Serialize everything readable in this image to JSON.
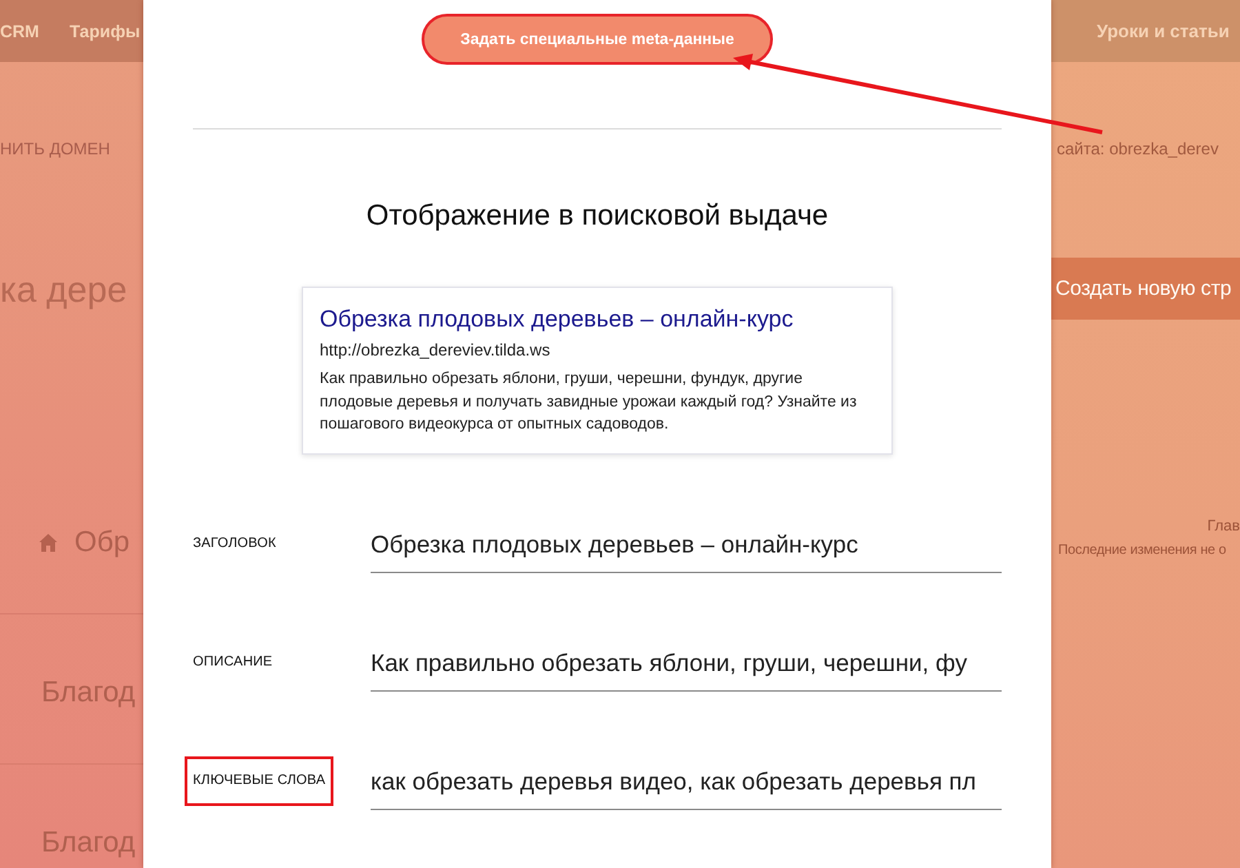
{
  "background_page": {
    "left": {
      "nav_items": [
        "CRM",
        "Тарифы"
      ],
      "domain_link": "НИТЬ ДОМЕН",
      "project_title": "ка дере",
      "pages": [
        {
          "title": "Обр",
          "home": true
        },
        {
          "title": "Благод",
          "home": false
        },
        {
          "title": "Благод",
          "home": false
        }
      ]
    },
    "right": {
      "nav_items": [
        "Уроки и статьи"
      ],
      "site_address": "сайта: obrezka_derev",
      "create_page_button": "Создать новую стр",
      "page_status": {
        "title": "Глав",
        "note": "Последние изменения не о"
      }
    }
  },
  "modal": {
    "meta_button": {
      "label": "Задать специальные meta-данные",
      "highlighted": true
    },
    "preview_heading": "Отображение в поисковой выдаче",
    "snippet": {
      "title": "Обрезка плодовых деревьев – онлайн-курс",
      "url": "http://obrezka_dereviev.tilda.ws",
      "description": "Как правильно обрезать яблони, груши, черешни, фундук, другие плодовые деревья и получать завидные урожаи каждый год? Узнайте из пошагового видеокурса от опытных садоводов."
    },
    "fields": [
      {
        "label": "ЗАГОЛОВОК",
        "value": "Обрезка плодовых деревьев – онлайн-курс",
        "highlighted": false
      },
      {
        "label": "ОПИСАНИЕ",
        "value": "Как правильно обрезать яблони, груши, черешни, фу",
        "highlighted": false
      },
      {
        "label": "КЛЮЧЕВЫЕ СЛОВА",
        "value": "как обрезать деревья видео, как обрезать деревья пл",
        "highlighted": true
      }
    ]
  }
}
